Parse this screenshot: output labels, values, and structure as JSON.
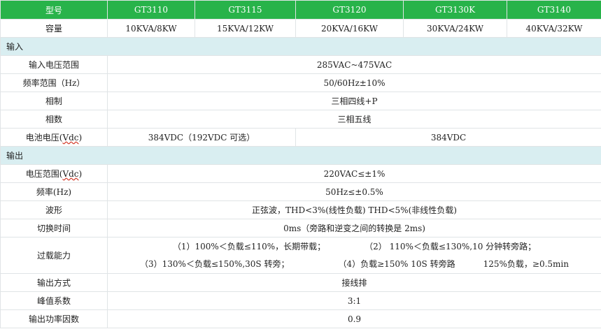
{
  "header": {
    "model_label": "型号",
    "models": [
      "GT3110",
      "GT3115",
      "GT3120",
      "GT3130K",
      "GT3140"
    ]
  },
  "capacity": {
    "label": "容量",
    "values": [
      "10KVA/8KW",
      "15KVA/12KW",
      "20KVA/16KW",
      "30KVA/24KW",
      "40KVA/32KW"
    ]
  },
  "input": {
    "section_label": "输入",
    "voltage_range": {
      "label": "输入电压范围",
      "value": "285VAC~475VAC"
    },
    "frequency_range": {
      "label": "频率范围（Hz）",
      "value": "50/60Hz±10%"
    },
    "phase_system": {
      "label": "相制",
      "value": "三相四线+P"
    },
    "phase_count": {
      "label": "相数",
      "value": "三相五线"
    },
    "battery_voltage": {
      "label_prefix": "电池电压(",
      "label_unit": "Vdc",
      "label_suffix": ")",
      "value_small": "384VDC（192VDC 可选）",
      "value_large": "384VDC"
    }
  },
  "output": {
    "section_label": "输出",
    "voltage_range": {
      "label_prefix": "电压范围(",
      "label_unit": "Vdc",
      "label_suffix": ")",
      "value": "220VAC≤±1%"
    },
    "frequency": {
      "label": "频率(Hz)",
      "value": "50Hz≤±0.5%"
    },
    "waveform": {
      "label": "波形",
      "value": "正弦波，THD<3%(线性负载) THD<5%(非线性负载)"
    },
    "transfer_time": {
      "label": "切换时间",
      "value": "0ms（旁路和逆变之间的转换是 2ms)"
    },
    "overload": {
      "label": "过载能力",
      "item1": "（1）100%＜负载≤110%，长期带载；",
      "item2": "（2） 110%＜负载≤130%,10 分钟转旁路；",
      "item3": "（3）130%＜负载≤150%,30S 转旁；",
      "item4": "（4）负载≥150% 10S 转旁路",
      "item5": "125%负载，≥0.5min"
    },
    "output_mode": {
      "label": "输出方式",
      "value": "接线排"
    },
    "crest_factor": {
      "label": "峰值系数",
      "value": "3:1"
    },
    "power_factor": {
      "label": "输出功率因数",
      "value": "0.9"
    }
  }
}
